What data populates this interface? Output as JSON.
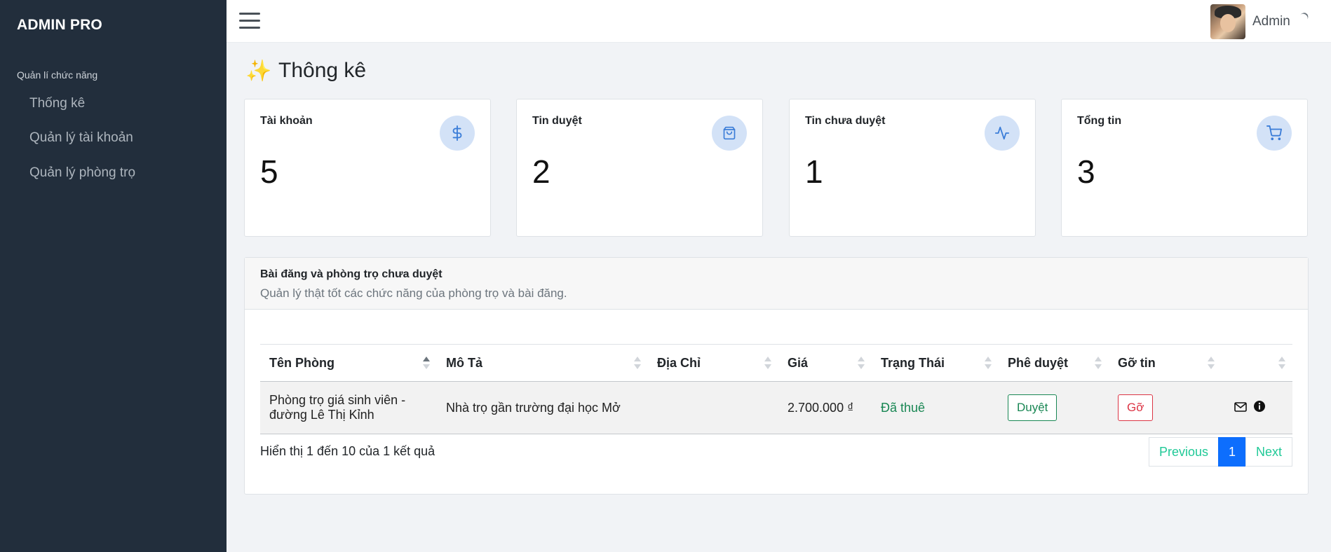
{
  "sidebar": {
    "brand": "ADMIN PRO",
    "section_header": "Quản lí chức năng",
    "items": [
      {
        "label": "Thống kê"
      },
      {
        "label": "Quản lý tài khoản"
      },
      {
        "label": "Quản lý phòng trọ"
      }
    ]
  },
  "topbar": {
    "menu_icon": "hamburger-icon",
    "user_name": "Admin"
  },
  "page": {
    "title_icon": "sparkles",
    "title": "Thông kê"
  },
  "stats": [
    {
      "title": "Tài khoản",
      "value": "5",
      "icon": "dollar-icon"
    },
    {
      "title": "Tin duyệt",
      "value": "2",
      "icon": "shopping-bag-icon"
    },
    {
      "title": "Tin chưa duyệt",
      "value": "1",
      "icon": "activity-icon"
    },
    {
      "title": "Tổng tin",
      "value": "3",
      "icon": "shopping-cart-icon"
    }
  ],
  "colors": {
    "sidebar_bg": "#222e3c",
    "accent": "#0d6efd",
    "success": "#198754",
    "danger": "#dc3545",
    "icon_circle": "#d3e2f7"
  },
  "panel": {
    "title": "Bài đăng và phòng trọ chưa duyệt",
    "subtitle": "Quản lý thật tốt các chức năng của phòng trọ và bài đăng.",
    "columns": [
      "Tên Phòng",
      "Mô Tả",
      "Địa Chỉ",
      "Giá",
      "Trạng Thái",
      "Phê duyệt",
      "Gỡ tin",
      ""
    ],
    "rows": [
      {
        "name_line1": "Phòng trọ giá sinh viên -",
        "name_line2": "đường Lê Thị Kỉnh",
        "description": "Nhà trọ gần trường đại học Mở",
        "address": "",
        "price": "2.700.000 ₫",
        "status": "Đã thuê",
        "approve_label": "Duyệt",
        "remove_label": "Gỡ"
      }
    ],
    "info": "Hiển thị 1 đến 10 của 1 kết quả",
    "pagination": {
      "previous": "Previous",
      "current": "1",
      "next": "Next"
    }
  }
}
